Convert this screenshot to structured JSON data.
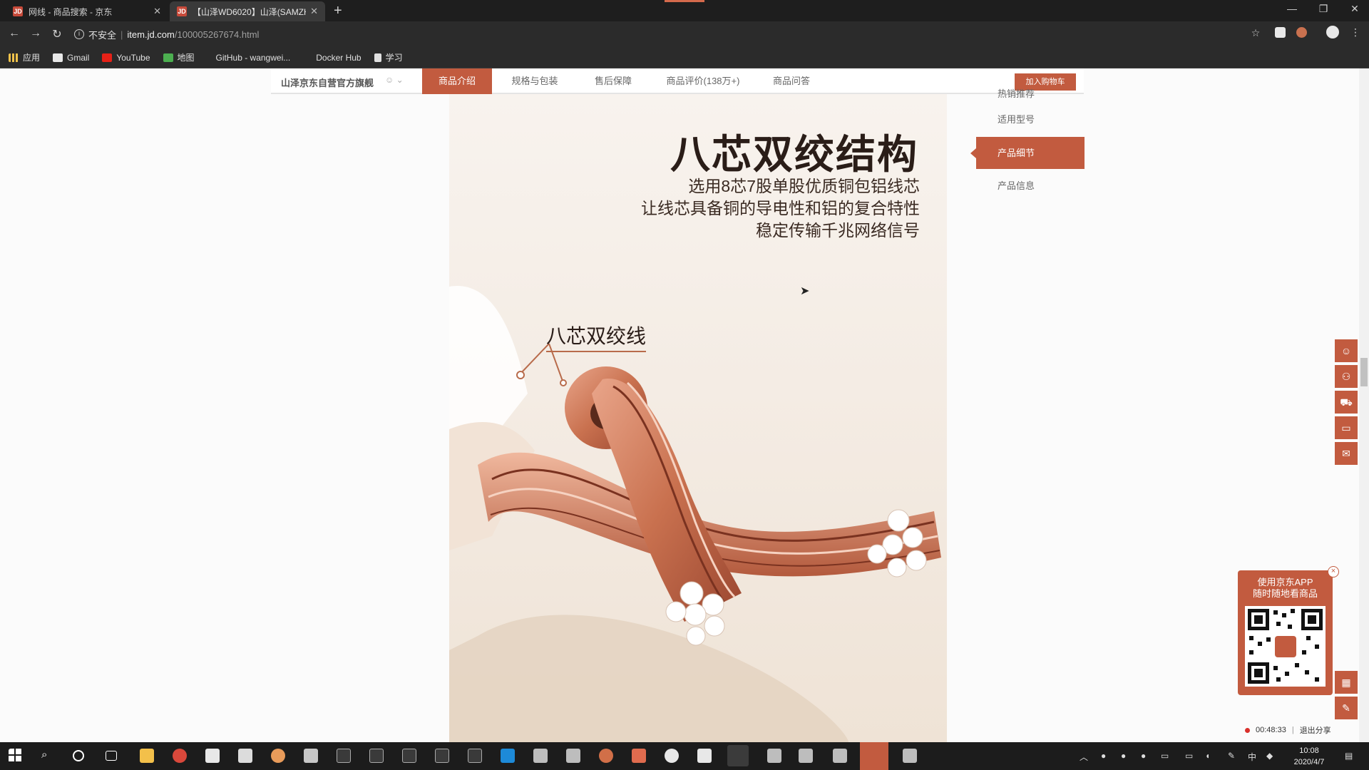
{
  "browser": {
    "tabs": [
      {
        "title": "网线 - 商品搜索 - 京东",
        "active": false,
        "favicon": "JD"
      },
      {
        "title": "【山泽WD6020】山泽(SAMZHI",
        "active": true,
        "favicon": "JD"
      }
    ],
    "new_tab": "+",
    "security_label": "不安全",
    "url_domain": "item.jd.com",
    "url_path": "/100005267674.html",
    "bookmarks": [
      {
        "label": "应用",
        "icon": "apps-grid-icon",
        "color": "#f0c24a"
      },
      {
        "label": "Gmail",
        "icon": "gmail-icon",
        "color": "#e8e8e8"
      },
      {
        "label": "YouTube",
        "icon": "youtube-icon",
        "color": "#e62117"
      },
      {
        "label": "地图",
        "icon": "maps-icon",
        "color": "#4caf50"
      },
      {
        "label": "GitHub - wangwei...",
        "icon": "",
        "color": ""
      },
      {
        "label": "Docker Hub",
        "icon": "",
        "color": ""
      },
      {
        "label": "学习",
        "icon": "folder-icon",
        "color": "#e0e0e0"
      }
    ]
  },
  "product_nav": {
    "shop_name": "山泽京东自营官方旗舰",
    "tabs": [
      "商品介绍",
      "规格与包装",
      "售后保障",
      "商品评价(138万+)",
      "商品问答"
    ],
    "active_tab": 0,
    "add_to_cart": "加入购物车"
  },
  "hero": {
    "title": "八芯双绞结构",
    "subtitle_lines": [
      "选用8芯7股单股优质铜包铝线芯",
      "让线芯具备铜的导电性和铝的复合特性",
      "稳定传输千兆网络信号"
    ],
    "label": "八芯双绞线"
  },
  "side_nav": {
    "items": [
      "热销推荐",
      "适用型号",
      "产品细节",
      "产品信息"
    ],
    "active": 2
  },
  "qr_popup": {
    "title_lines": [
      "使用京东APP",
      "随时随地看商品"
    ],
    "close": "×"
  },
  "share_bar": {
    "timer": "00:48:33",
    "exit_label": "退出分享"
  },
  "taskbar": {
    "time": "10:08",
    "date": "2020/4/7",
    "ime_label": "中"
  },
  "colors": {
    "accent": "#c25b3f",
    "copper": "#c9714f"
  }
}
